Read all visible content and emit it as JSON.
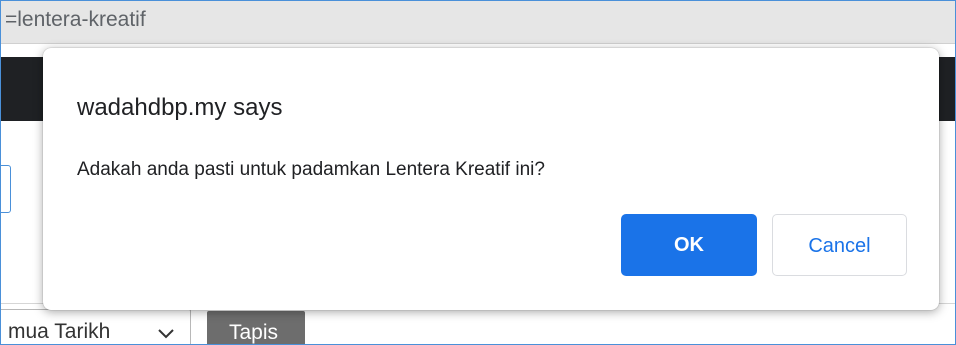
{
  "browser": {
    "url_fragment": "=lentera-kreatif"
  },
  "page": {
    "date_filter_selected": "mua Tarikh",
    "filter_button_label": "Tapis"
  },
  "dialog": {
    "title": "wadahdbp.my says",
    "message": "Adakah anda pasti untuk padamkan Lentera Kreatif ini?",
    "ok_label": "OK",
    "cancel_label": "Cancel"
  },
  "colors": {
    "primary_blue": "#1a73e8",
    "header_dark": "#1f2124",
    "filter_button_gray": "#6d6d6d"
  }
}
